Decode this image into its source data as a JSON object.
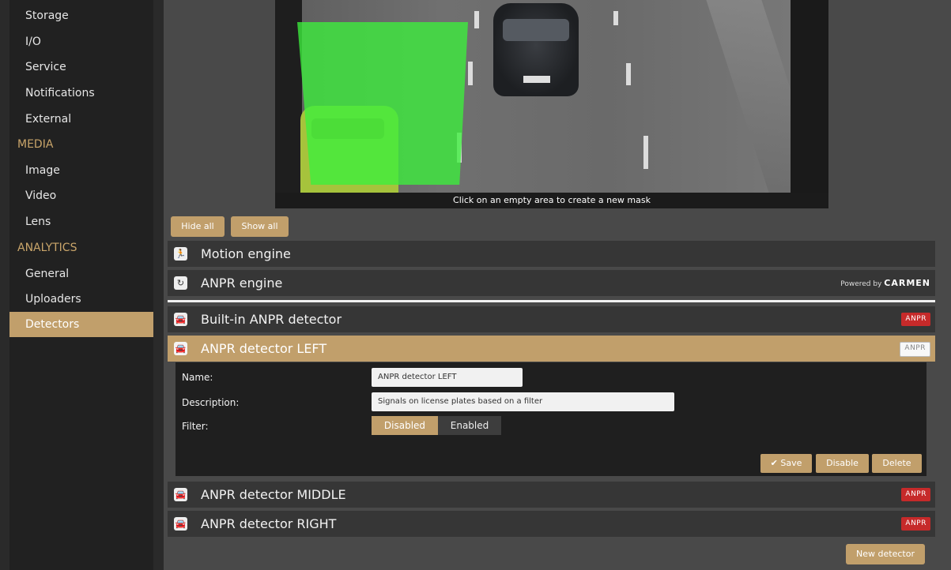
{
  "sidebar": {
    "items": [
      {
        "label": "Storage"
      },
      {
        "label": "I/O"
      },
      {
        "label": "Service"
      },
      {
        "label": "Notifications"
      },
      {
        "label": "External"
      }
    ],
    "sections": {
      "media": "MEDIA",
      "analytics": "ANALYTICS"
    },
    "media_items": [
      {
        "label": "Image"
      },
      {
        "label": "Video"
      },
      {
        "label": "Lens"
      }
    ],
    "analytics_items": [
      {
        "label": "General"
      },
      {
        "label": "Uploaders"
      },
      {
        "label": "Detectors"
      }
    ],
    "active": "Detectors"
  },
  "camera": {
    "caption": "Click on an empty area to create a new mask"
  },
  "mask_buttons": {
    "hide_all": "Hide all",
    "show_all": "Show all"
  },
  "engines": [
    {
      "title": "Motion engine",
      "icon": "motion-runner-icon"
    },
    {
      "title": "ANPR engine",
      "icon": "anpr-cycle-icon",
      "powered_by": "Powered by",
      "brand": "CARMEN"
    }
  ],
  "detectors": [
    {
      "title": "Built-in ANPR detector",
      "badge": "ANPR",
      "icon": "car-plate-icon"
    },
    {
      "title": "ANPR detector LEFT",
      "badge": "ANPR",
      "icon": "car-plate-icon"
    },
    {
      "title": "ANPR detector MIDDLE",
      "badge": "ANPR",
      "icon": "car-plate-icon"
    },
    {
      "title": "ANPR detector RIGHT",
      "badge": "ANPR",
      "icon": "car-plate-icon"
    }
  ],
  "form": {
    "name_label": "Name:",
    "name_value": "ANPR detector LEFT",
    "description_label": "Description:",
    "description_value": "Signals on license plates based on a filter",
    "filter_label": "Filter:",
    "filter_options": [
      "Disabled",
      "Enabled"
    ],
    "filter_selected": "Disabled",
    "save": "Save",
    "disable": "Disable",
    "delete": "Delete"
  },
  "new_detector": "New detector",
  "colors": {
    "accent": "#c19f6b",
    "badge_red": "#c62a2a",
    "mask_green": "#3cf03c"
  }
}
